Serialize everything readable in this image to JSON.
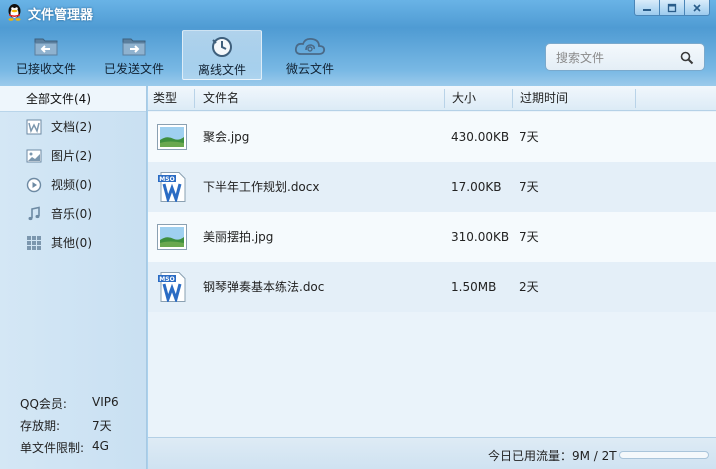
{
  "window": {
    "title": "文件管理器"
  },
  "toolbar": {
    "items": [
      {
        "label": "已接收文件",
        "icon": "folder-download-icon"
      },
      {
        "label": "已发送文件",
        "icon": "folder-upload-icon"
      },
      {
        "label": "离线文件",
        "icon": "clock-icon"
      },
      {
        "label": "微云文件",
        "icon": "cloud-icon"
      }
    ],
    "active_index": 2
  },
  "search": {
    "placeholder": "搜索文件",
    "value": ""
  },
  "sidebar": {
    "all_label": "全部文件(4)",
    "items": [
      {
        "label": "文档(2)",
        "icon": "document-icon"
      },
      {
        "label": "图片(2)",
        "icon": "image-icon"
      },
      {
        "label": "视频(0)",
        "icon": "play-icon"
      },
      {
        "label": "音乐(0)",
        "icon": "music-note-icon"
      },
      {
        "label": "其他(0)",
        "icon": "grid-icon"
      }
    ],
    "info": [
      {
        "label": "QQ会员:",
        "value": "VIP6"
      },
      {
        "label": "存放期:",
        "value": "7天"
      },
      {
        "label": "单文件限制:",
        "value": "4G"
      }
    ]
  },
  "table": {
    "columns": [
      "类型",
      "文件名",
      "大小",
      "过期时间"
    ],
    "rows": [
      {
        "type": "image",
        "icon": "jpg-file-icon",
        "name": "聚会.jpg",
        "size": "430.00KB",
        "expires": "7天"
      },
      {
        "type": "doc",
        "icon": "word-file-icon",
        "name": "下半年工作规划.docx",
        "size": "17.00KB",
        "expires": "7天"
      },
      {
        "type": "image",
        "icon": "jpg-file-icon",
        "name": "美丽摆拍.jpg",
        "size": "310.00KB",
        "expires": "7天"
      },
      {
        "type": "doc",
        "icon": "word-file-icon",
        "name": "钢琴弹奏基本练法.doc",
        "size": "1.50MB",
        "expires": "2天"
      }
    ]
  },
  "status": {
    "traffic_text": "今日已用流量：9M / 2T",
    "traffic_fraction": 0.0
  },
  "colors": {
    "accent": "#4f9bd3",
    "row_alt": "#f5fafd",
    "row_base": "#e4eff8"
  }
}
